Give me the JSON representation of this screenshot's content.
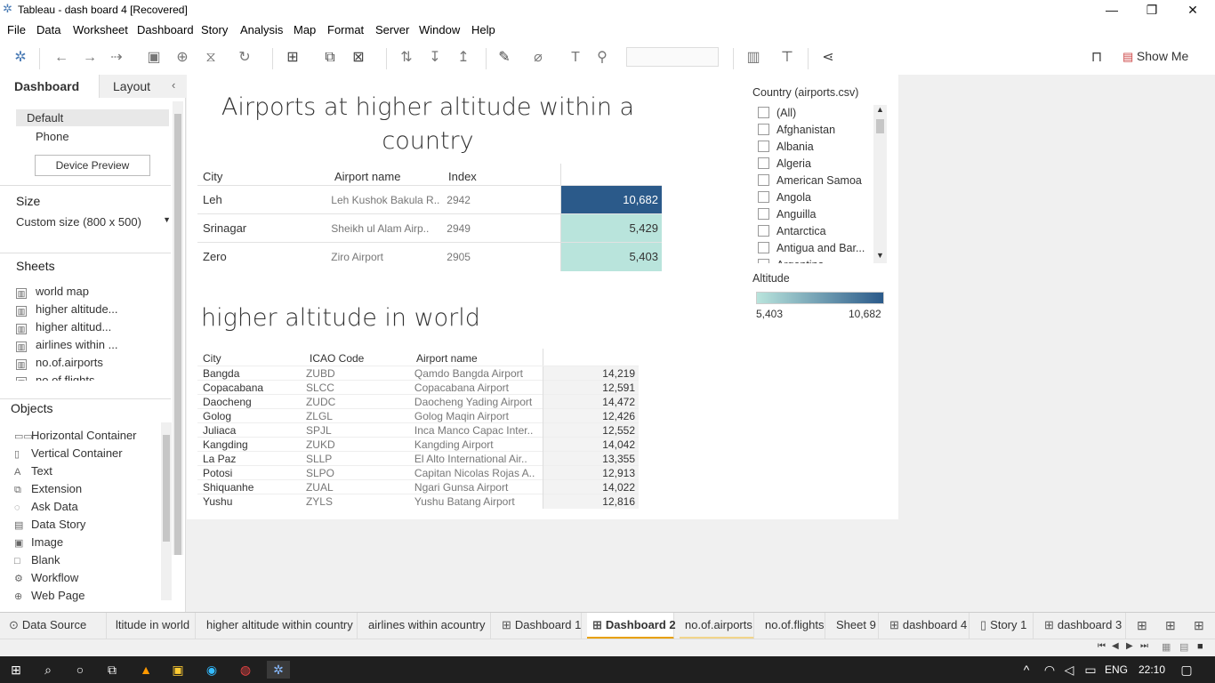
{
  "window": {
    "title": "Tableau - dash board 4 [Recovered]"
  },
  "menu": [
    "File",
    "Data",
    "Worksheet",
    "Dashboard",
    "Story",
    "Analysis",
    "Map",
    "Format",
    "Server",
    "Window",
    "Help"
  ],
  "toolbar": {
    "show_me": "Show Me"
  },
  "leftpane": {
    "tab_dashboard": "Dashboard",
    "tab_layout": "Layout",
    "device_default": "Default",
    "device_phone": "Phone",
    "device_preview": "Device Preview",
    "size_title": "Size",
    "size_value": "Custom size (800 x 500)",
    "sheets_title": "Sheets",
    "sheets": [
      "world map",
      "higher altitude...",
      "higher altitud...",
      "airlines within ...",
      "no.of.airports",
      "no.of.flights"
    ],
    "objects_title": "Objects",
    "objects": [
      {
        "label": "Horizontal Container",
        "icon": "horizontal-container-icon",
        "glyph": "▭▭"
      },
      {
        "label": "Vertical Container",
        "icon": "vertical-container-icon",
        "glyph": "▯"
      },
      {
        "label": "Text",
        "icon": "text-icon",
        "glyph": "A"
      },
      {
        "label": "Extension",
        "icon": "extension-icon",
        "glyph": "⧉"
      },
      {
        "label": "Ask Data",
        "icon": "ask-data-icon",
        "glyph": "◌"
      },
      {
        "label": "Data Story",
        "icon": "data-story-icon",
        "glyph": "▤"
      },
      {
        "label": "Image",
        "icon": "image-icon",
        "glyph": "▣"
      },
      {
        "label": "Blank",
        "icon": "blank-icon",
        "glyph": "□"
      },
      {
        "label": "Workflow",
        "icon": "workflow-icon",
        "glyph": "⚙"
      },
      {
        "label": "Web Page",
        "icon": "web-page-icon",
        "glyph": "⊕"
      }
    ]
  },
  "dashboard": {
    "title1": "Airports at higher altitude within a country",
    "table1": {
      "headers": [
        "City",
        "Airport name",
        "Index",
        ""
      ],
      "rows": [
        {
          "city": "Leh",
          "airport": "Leh Kushok Bakula R..",
          "index": "2942",
          "value": "10,682",
          "color": "#2b5a8a"
        },
        {
          "city": "Srinagar",
          "airport": "Sheikh ul Alam Airp..",
          "index": "2949",
          "value": "5,429",
          "color": "#b9e4dc"
        },
        {
          "city": "Zero",
          "airport": "Ziro Airport",
          "index": "2905",
          "value": "5,403",
          "color": "#b9e4dc"
        }
      ]
    },
    "title2": "higher altitude in world",
    "table2": {
      "headers": [
        "City",
        "ICAO Code",
        "Airport name",
        ""
      ],
      "rows": [
        {
          "city": "Bangda",
          "icao": "ZUBD",
          "airport": "Qamdo Bangda Airport",
          "value": "14,219"
        },
        {
          "city": "Copacabana",
          "icao": "SLCC",
          "airport": "Copacabana Airport",
          "value": "12,591"
        },
        {
          "city": "Daocheng",
          "icao": "ZUDC",
          "airport": "Daocheng Yading Airport",
          "value": "14,472"
        },
        {
          "city": "Golog",
          "icao": "ZLGL",
          "airport": "Golog Maqin Airport",
          "value": "12,426"
        },
        {
          "city": "Juliaca",
          "icao": "SPJL",
          "airport": "Inca Manco Capac Inter..",
          "value": "12,552"
        },
        {
          "city": "Kangding",
          "icao": "ZUKD",
          "airport": "Kangding Airport",
          "value": "14,042"
        },
        {
          "city": "La Paz",
          "icao": "SLLP",
          "airport": "El Alto International Air..",
          "value": "13,355"
        },
        {
          "city": "Potosi",
          "icao": "SLPO",
          "airport": "Capitan Nicolas Rojas A..",
          "value": "12,913"
        },
        {
          "city": "Shiquanhe",
          "icao": "ZUAL",
          "airport": "Ngari Gunsa Airport",
          "value": "14,022"
        },
        {
          "city": "Yushu",
          "icao": "ZYLS",
          "airport": "Yushu Batang Airport",
          "value": "12,816"
        }
      ]
    },
    "filter": {
      "title": "Country (airports.csv)",
      "items": [
        "(All)",
        "Afghanistan",
        "Albania",
        "Algeria",
        "American Samoa",
        "Angola",
        "Anguilla",
        "Antarctica",
        "Antigua and Bar...",
        "Argentina"
      ]
    },
    "legend": {
      "title": "Altitude",
      "min": "5,403",
      "max": "10,682",
      "color_low": "#b9e4dc",
      "color_high": "#2b5a8a"
    }
  },
  "bottom_tabs": [
    {
      "label": "Data Source",
      "icon": "data-source-icon"
    },
    {
      "label": "ltitude in world",
      "icon": ""
    },
    {
      "label": "higher altitude within country",
      "icon": ""
    },
    {
      "label": "airlines within acountry",
      "icon": ""
    },
    {
      "label": "Dashboard 1",
      "icon": "dashboard-icon"
    },
    {
      "label": "Dashboard 2",
      "icon": "dashboard-icon"
    },
    {
      "label": "no.of.airports",
      "icon": ""
    },
    {
      "label": "no.of.flights",
      "icon": ""
    },
    {
      "label": "Sheet 9",
      "icon": ""
    },
    {
      "label": "dashboard 4",
      "icon": "dashboard-icon"
    },
    {
      "label": "Story 1",
      "icon": "story-icon"
    },
    {
      "label": "dashboard 3",
      "icon": "dashboard-icon"
    }
  ],
  "taskbar": {
    "lang": "ENG",
    "time": "22:10"
  }
}
